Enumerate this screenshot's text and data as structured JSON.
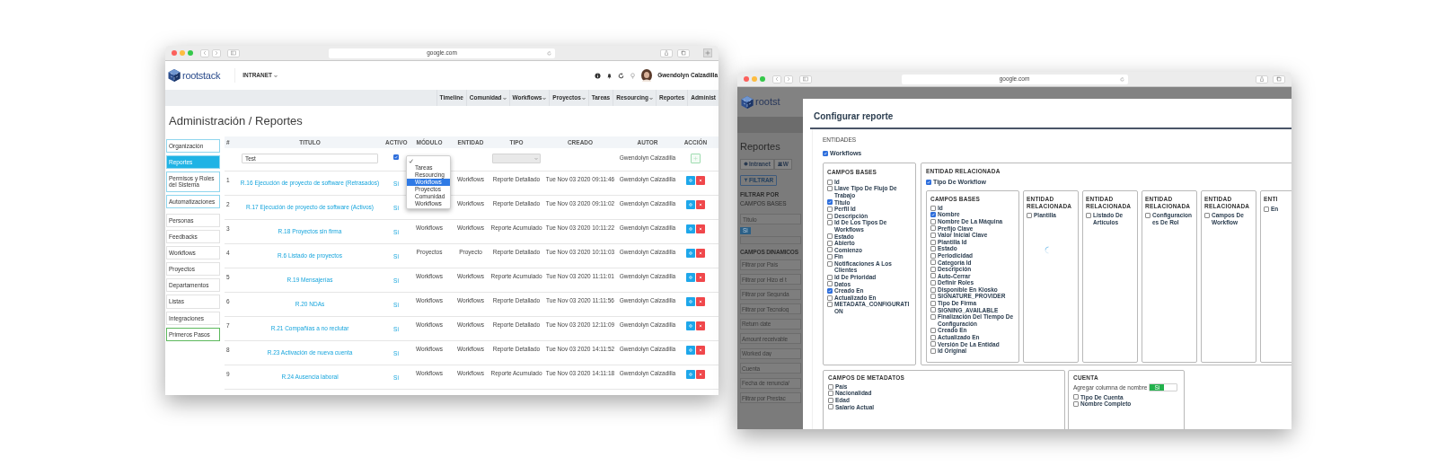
{
  "list_window": {
    "url": "google.com",
    "logo": "rootstack",
    "site_menu": "INTRANET",
    "user_name": "Gwendolyn Calzadilla",
    "nav": [
      {
        "label": "Timeline",
        "dropdown": false
      },
      {
        "label": "Comunidad",
        "dropdown": true
      },
      {
        "label": "Workflows",
        "dropdown": true
      },
      {
        "label": "Proyectos",
        "dropdown": true
      },
      {
        "label": "Tareas",
        "dropdown": false
      },
      {
        "label": "Resourcing",
        "dropdown": true
      },
      {
        "label": "Reportes",
        "dropdown": false
      },
      {
        "label": "Administ",
        "dropdown": false
      }
    ],
    "page_title": "Administración / Reportes",
    "sidebar": {
      "groups": [
        {
          "items": [
            {
              "label": "Organización",
              "selected": false,
              "color": "#8fd6ee"
            },
            {
              "label": "Reportes",
              "selected": true,
              "color": "#8fd6ee"
            },
            {
              "label": "Permisos y Roles del Sistema",
              "selected": false,
              "color": "#8fd6ee"
            },
            {
              "label": "Automatizaciones",
              "selected": false,
              "color": "#8fd6ee"
            }
          ]
        },
        {
          "items": [
            {
              "label": "Personas",
              "selected": false,
              "color": "#e2e2e2"
            },
            {
              "label": "Feedbacks",
              "selected": false,
              "color": "#e2e2e2"
            },
            {
              "label": "Workflows",
              "selected": false,
              "color": "#e2e2e2"
            },
            {
              "label": "Proyectos",
              "selected": false,
              "color": "#e2e2e2"
            },
            {
              "label": "Departamentos",
              "selected": false,
              "color": "#e2e2e2"
            },
            {
              "label": "Listas",
              "selected": false,
              "color": "#e2e2e2"
            },
            {
              "label": "Integraciones",
              "selected": false,
              "color": "#e2e2e2"
            },
            {
              "label": "Primeros Pasos",
              "selected": false,
              "color": "#5cb85c"
            }
          ]
        }
      ]
    },
    "table": {
      "columns": [
        "#",
        "TITULO",
        "ACTIVO",
        "MÓDULO",
        "ENTIDAD",
        "TIPO",
        "CREADO",
        "AUTOR",
        "ACCIÓN"
      ],
      "filter": {
        "title": "Test",
        "active": true,
        "author": "Gwendolyn Calzadilla",
        "module_options": [
          {
            "checked": true,
            "highlighted": false
          },
          {
            "label": "Tareas",
            "checked": false,
            "highlighted": false
          },
          {
            "label": "Resourcing",
            "checked": false,
            "highlighted": false
          },
          {
            "label": "Workflows",
            "checked": false,
            "highlighted": true
          },
          {
            "label": "Proyectos",
            "checked": false,
            "highlighted": false
          },
          {
            "label": "Comunidad",
            "checked": false,
            "highlighted": false
          },
          {
            "label": "Workflows",
            "checked": false,
            "highlighted": false
          }
        ]
      },
      "rows": [
        {
          "number": "1",
          "title": "R.16 Ejecución de proyecto de software (Retrasados)",
          "active": "Si",
          "entity": "Workflows",
          "type": "Reporte Detallado",
          "created": "Tue Nov 03 2020 09:11:46",
          "author": "Gwendolyn Calzadilla"
        },
        {
          "number": "2",
          "title": "R.17 Ejecución de proyecto de software (Activos)",
          "active": "Si",
          "entity": "Workflows",
          "type": "Reporte Detallado",
          "created": "Tue Nov 03 2020 09:11:02",
          "author": "Gwendolyn Calzadilla"
        },
        {
          "number": "3",
          "title": "R.18 Proyectos sin firma",
          "active": "Si",
          "module": "Workflows",
          "entity": "Workflows",
          "type": "Reporte Acumulado",
          "created": "Tue Nov 03 2020 10:11:22",
          "author": "Gwendolyn Calzadilla"
        },
        {
          "number": "4",
          "title": "R.6 Listado de proyectos",
          "active": "Si",
          "module": "Proyectos",
          "entity": "Proyecto",
          "type": "Reporte Detallado",
          "created": "Tue Nov 03 2020 10:11:03",
          "author": "Gwendolyn Calzadilla"
        },
        {
          "number": "5",
          "title": "R.19 Mensajerías",
          "active": "Si",
          "module": "Workflows",
          "entity": "Workflows",
          "type": "Reporte Acumulado",
          "created": "Tue Nov 03 2020 11:11:01",
          "author": "Gwendolyn Calzadilla"
        },
        {
          "number": "6",
          "title": "R.20 NDAs",
          "active": "Si",
          "module": "Workflows",
          "entity": "Workflows",
          "type": "Reporte Detallado",
          "created": "Tue Nov 03 2020 11:11:56",
          "author": "Gwendolyn Calzadilla"
        },
        {
          "number": "7",
          "title": "R.21 Compañías a no reclutar",
          "active": "Si",
          "module": "Workflows",
          "entity": "Workflows",
          "type": "Reporte Detallado",
          "created": "Tue Nov 03 2020 12:11:09",
          "author": "Gwendolyn Calzadilla"
        },
        {
          "number": "8",
          "title": "R.23 Activación de nueva cuenta",
          "active": "Si",
          "module": "Workflows",
          "entity": "Workflows",
          "type": "Reporte Detallado",
          "created": "Tue Nov 03 2020 14:11:52",
          "author": "Gwendolyn Calzadilla"
        },
        {
          "number": "9",
          "title": "R.24 Ausencia laboral",
          "active": "Si",
          "module": "Workflows",
          "entity": "Workflows",
          "type": "Reporte Acumulado",
          "created": "Tue Nov 03 2020 14:11:18",
          "author": "Gwendolyn Calzadilla"
        }
      ]
    }
  },
  "config_window": {
    "url": "google.com",
    "background": {
      "logo": "rootst",
      "title": "Reportes",
      "buttons": [
        "Intranet",
        "W"
      ],
      "filter_button": "FILTRAR",
      "filter_by": "FILTRAR POR",
      "base_fields_heading": "CAMPOS BASES",
      "title_placeholder": "Titulo",
      "toggle": {
        "label": "Si",
        "on": true
      },
      "dynamic_fields_heading": "CAMPOS DINAMICOS",
      "dynamic_fields": [
        {
          "placeholder": "Filtrar por País"
        },
        {
          "placeholder": "Filtrar por Hizo el t"
        },
        {
          "placeholder": "Filtrar por Segunda"
        },
        {
          "placeholder": "Filtrar por Tecnolog"
        },
        {
          "placeholder": "Return date"
        },
        {
          "placeholder": "Amount receivable"
        },
        {
          "placeholder": "Worked day"
        },
        {
          "placeholder": "Cuenta"
        },
        {
          "placeholder": "Fecha de renuncia/"
        },
        {
          "placeholder": "Filtrar por Prestac"
        }
      ]
    },
    "modal": {
      "title": "Configurar reporte",
      "entities_heading": "ENTIDADES",
      "entity": {
        "label": "Workflows",
        "checked": true
      },
      "base_fields": {
        "heading": "CAMPOS BASES",
        "fields": [
          {
            "label": "Id",
            "checked": false
          },
          {
            "label": "Llave Tipo De Flujo De Trabajo",
            "checked": false
          },
          {
            "label": "Titulo",
            "checked": true
          },
          {
            "label": "Perfil Id",
            "checked": false
          },
          {
            "label": "Descripción",
            "checked": false
          },
          {
            "label": "Id De Los Tipos De Workflows",
            "checked": false
          },
          {
            "label": "Estado",
            "checked": false
          },
          {
            "label": "Abierto",
            "checked": false
          },
          {
            "label": "Comienzo",
            "checked": false
          },
          {
            "label": "Fin",
            "checked": false
          },
          {
            "label": "Notificaciones A Los Clientes",
            "checked": false
          },
          {
            "label": "Id De Prioridad",
            "checked": false
          },
          {
            "label": "Datos",
            "checked": false
          },
          {
            "label": "Creado En",
            "checked": true
          },
          {
            "label": "Actualizado En",
            "checked": false
          },
          {
            "label": "METADATA_CONFIGURATION",
            "checked": false
          }
        ]
      },
      "related": {
        "heading": "ENTIDAD RELACIONADA",
        "entity": {
          "label": "Tipo De Workflow",
          "checked": true
        },
        "base_fields": {
          "heading": "CAMPOS BASES",
          "fields": [
            {
              "label": "Id",
              "checked": false
            },
            {
              "label": "Nombre",
              "checked": true
            },
            {
              "label": "Nombre De La Máquina",
              "checked": false
            },
            {
              "label": "Prefijo Clave",
              "checked": false
            },
            {
              "label": "Valor Inicial Clave",
              "checked": false
            },
            {
              "label": "Plantilla Id",
              "checked": false
            },
            {
              "label": "Estado",
              "checked": false
            },
            {
              "label": "Periodicidad",
              "checked": false
            },
            {
              "label": "Categoría Id",
              "checked": false
            },
            {
              "label": "Descripción",
              "checked": false
            },
            {
              "label": "Auto-Cerrar",
              "checked": false
            },
            {
              "label": "Definir Roles",
              "checked": false
            },
            {
              "label": "Disponible En Kiosko",
              "checked": false
            },
            {
              "label": "SIGNATURE_PROVIDER",
              "checked": false
            },
            {
              "label": "Tipo De Firma",
              "checked": false
            },
            {
              "label": "SIGNING_AVAILABLE",
              "checked": false
            },
            {
              "label": "Finalización Del Tiempo De Configuración",
              "checked": false
            },
            {
              "label": "Creado En",
              "checked": false
            },
            {
              "label": "Actualizado En",
              "checked": false
            },
            {
              "label": "Versión De La Entidad",
              "checked": false
            },
            {
              "label": "Id Original",
              "checked": false
            }
          ]
        },
        "related": [
          {
            "heading": "ENTIDAD RELACIONADA",
            "label": "Plantilla",
            "checked": false,
            "loading": true
          },
          {
            "heading": "ENTIDAD RELACIONADA",
            "label": "Listado De Artículos",
            "checked": false,
            "loading": false
          },
          {
            "heading": "ENTIDAD RELACIONADA",
            "label": "Configuraciones De Rol",
            "checked": false,
            "loading": false
          },
          {
            "heading": "ENTIDAD RELACIONADA",
            "label": "Campos De Workflow",
            "checked": false,
            "loading": false
          },
          {
            "heading": "ENTI",
            "label": "En",
            "checked": false,
            "loading": false
          }
        ]
      },
      "metadata_fields": {
        "heading": "CAMPOS DE METADATOS",
        "fields": [
          {
            "label": "País",
            "checked": false
          },
          {
            "label": "Nacionalidad",
            "checked": false
          },
          {
            "label": "Edad",
            "checked": false
          },
          {
            "label": "Salario Actual",
            "checked": false
          }
        ]
      },
      "account": {
        "heading": "CUENTA",
        "toggle": {
          "label": "Agregar columna de nombre",
          "value": "Si",
          "on": true
        },
        "fields": [
          {
            "label": "Tipo De Cuenta",
            "checked": false
          },
          {
            "label": "Nombre Completo",
            "checked": false
          }
        ]
      }
    }
  }
}
